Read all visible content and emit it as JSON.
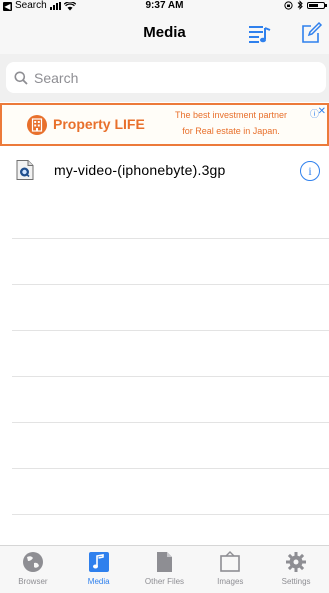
{
  "status_bar": {
    "back_label": "Search",
    "time": "9:37 AM"
  },
  "nav": {
    "title": "Media",
    "left_icon": "playlist-icon",
    "right_icon": "compose-icon"
  },
  "search": {
    "placeholder": "Search"
  },
  "ad": {
    "brand": "Property LIFE",
    "line1": "The best investment partner",
    "line2": "for Real estate in Japan."
  },
  "files": [
    {
      "name": "my-video-(iphonebyte).3gp"
    }
  ],
  "tabs": [
    {
      "label": "Browser",
      "icon": "globe-icon",
      "active": false
    },
    {
      "label": "Media",
      "icon": "music-note-icon",
      "active": true
    },
    {
      "label": "Other Files",
      "icon": "document-icon",
      "active": false
    },
    {
      "label": "Images",
      "icon": "image-icon",
      "active": false
    },
    {
      "label": "Settings",
      "icon": "gear-icon",
      "active": false
    }
  ],
  "colors": {
    "accent": "#2f80ed",
    "ad_orange": "#e8702c",
    "tab_inactive": "#8e8e93"
  }
}
